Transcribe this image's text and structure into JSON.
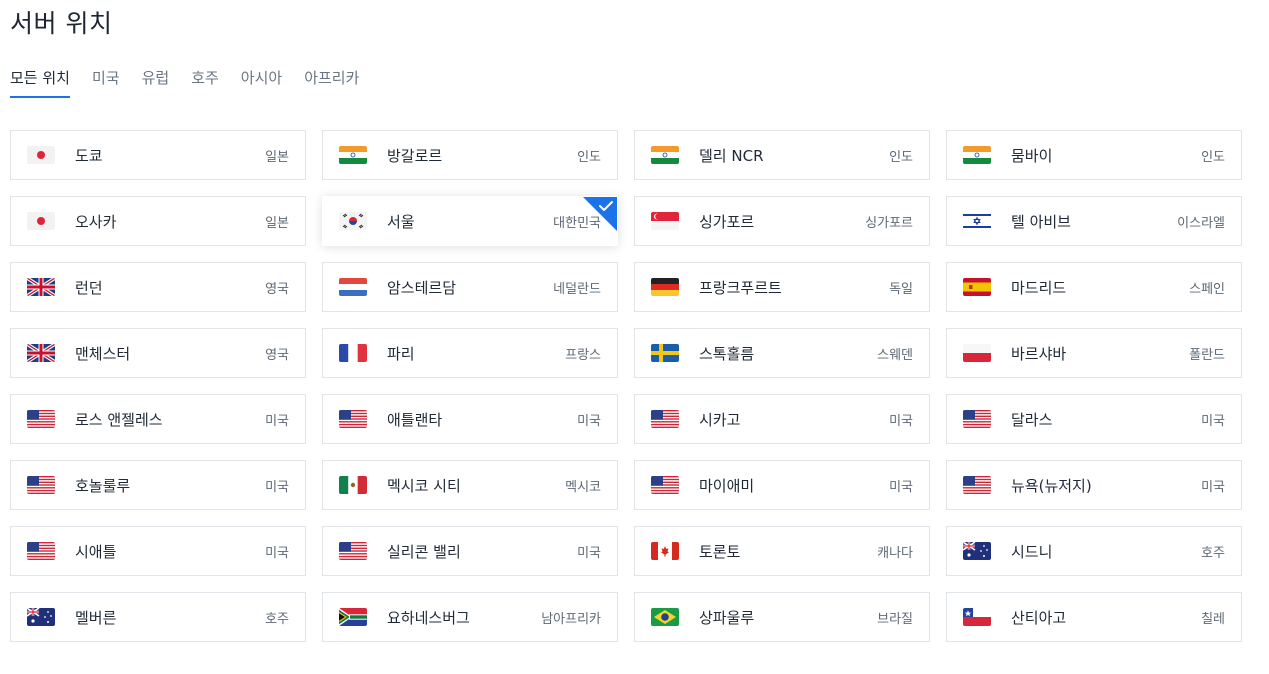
{
  "page": {
    "title": "서버 위치"
  },
  "tabs": [
    {
      "label": "모든 위치",
      "active": true
    },
    {
      "label": "미국"
    },
    {
      "label": "유럽"
    },
    {
      "label": "호주"
    },
    {
      "label": "아시아"
    },
    {
      "label": "아프리카"
    }
  ],
  "locations": [
    {
      "city": "도쿄",
      "country": "일본",
      "flag": "jp"
    },
    {
      "city": "방갈로르",
      "country": "인도",
      "flag": "in"
    },
    {
      "city": "델리 NCR",
      "country": "인도",
      "flag": "in"
    },
    {
      "city": "뭄바이",
      "country": "인도",
      "flag": "in"
    },
    {
      "city": "오사카",
      "country": "일본",
      "flag": "jp"
    },
    {
      "city": "서울",
      "country": "대한민국",
      "flag": "kr",
      "selected": true
    },
    {
      "city": "싱가포르",
      "country": "싱가포르",
      "flag": "sg"
    },
    {
      "city": "텔 아비브",
      "country": "이스라엘",
      "flag": "il"
    },
    {
      "city": "런던",
      "country": "영국",
      "flag": "gb"
    },
    {
      "city": "암스테르담",
      "country": "네덜란드",
      "flag": "nl"
    },
    {
      "city": "프랑크푸르트",
      "country": "독일",
      "flag": "de"
    },
    {
      "city": "마드리드",
      "country": "스페인",
      "flag": "es"
    },
    {
      "city": "맨체스터",
      "country": "영국",
      "flag": "gb"
    },
    {
      "city": "파리",
      "country": "프랑스",
      "flag": "fr"
    },
    {
      "city": "스톡홀름",
      "country": "스웨덴",
      "flag": "se"
    },
    {
      "city": "바르샤바",
      "country": "폴란드",
      "flag": "pl"
    },
    {
      "city": "로스 앤젤레스",
      "country": "미국",
      "flag": "us"
    },
    {
      "city": "애틀랜타",
      "country": "미국",
      "flag": "us"
    },
    {
      "city": "시카고",
      "country": "미국",
      "flag": "us"
    },
    {
      "city": "달라스",
      "country": "미국",
      "flag": "us"
    },
    {
      "city": "호놀룰루",
      "country": "미국",
      "flag": "us"
    },
    {
      "city": "멕시코 시티",
      "country": "멕시코",
      "flag": "mx"
    },
    {
      "city": "마이애미",
      "country": "미국",
      "flag": "us"
    },
    {
      "city": "뉴욕(뉴저지)",
      "country": "미국",
      "flag": "us"
    },
    {
      "city": "시애틀",
      "country": "미국",
      "flag": "us"
    },
    {
      "city": "실리콘 밸리",
      "country": "미국",
      "flag": "us"
    },
    {
      "city": "토론토",
      "country": "캐나다",
      "flag": "ca"
    },
    {
      "city": "시드니",
      "country": "호주",
      "flag": "au"
    },
    {
      "city": "멜버른",
      "country": "호주",
      "flag": "au"
    },
    {
      "city": "요하네스버그",
      "country": "남아프리카",
      "flag": "za"
    },
    {
      "city": "상파울루",
      "country": "브라질",
      "flag": "br"
    },
    {
      "city": "산티아고",
      "country": "칠레",
      "flag": "cl"
    }
  ],
  "colors": {
    "accent": "#1a73e8",
    "border": "#e1e4e8"
  }
}
